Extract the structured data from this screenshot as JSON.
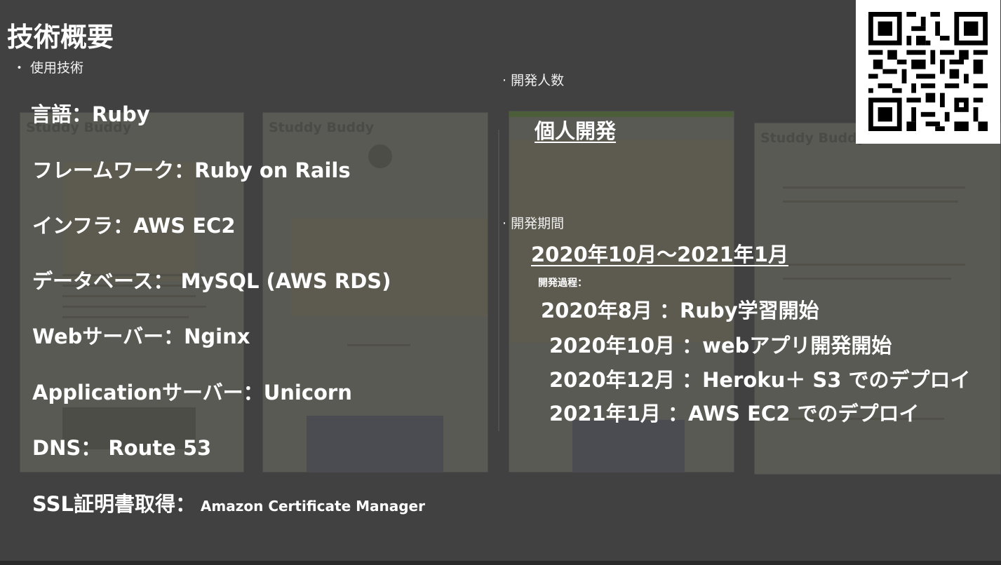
{
  "title": "技術概要",
  "tech_section_label": "・ 使用技術",
  "tech_stack": [
    {
      "label": "言語：",
      "value": "Ruby"
    },
    {
      "label": "フレームワーク：",
      "value": "Ruby on Rails"
    },
    {
      "label": "インフラ：",
      "value": "AWS EC2"
    },
    {
      "label": "データベース：",
      "value": " MySQL (AWS RDS)"
    },
    {
      "label": "Webサーバー：",
      "value": "Nginx"
    },
    {
      "label": "Applicationサーバー：",
      "value": "Unicorn"
    },
    {
      "label": "DNS：",
      "value": " Route 53"
    },
    {
      "label": "SSL証明書取得：",
      "value": " Amazon Certificate Manager"
    }
  ],
  "team": {
    "label": "· 開発人数",
    "value": "個人開発"
  },
  "period": {
    "label": "· 開発期間",
    "value": "2020年10月〜2021年1月",
    "process_label": "開発過程：",
    "steps": [
      "2020年8月 ：Ruby学習開始",
      "2020年10月 ：webアプリ開発開始",
      "2020年12月 ：Heroku＋ S3 でのデプロイ",
      "2021年1月 ：AWS EC2 でのデプロイ"
    ]
  },
  "background_brand": "Studdy Buddy",
  "colors": {
    "slide_bg": "#414141",
    "text": "#ffffff"
  },
  "icons": [
    "qr-code-icon"
  ]
}
